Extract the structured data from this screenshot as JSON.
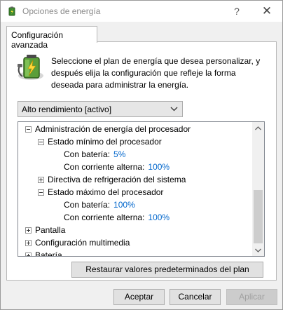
{
  "window": {
    "title": "Opciones de energía",
    "help_glyph": "?",
    "close_glyph": "✕"
  },
  "tab": {
    "label": "Configuración avanzada"
  },
  "intro": {
    "text": "Seleccione el plan de energía que desea personalizar, y después elija la configuración que refleje la forma deseada para administrar la energía."
  },
  "plan_select": {
    "value": "Alto rendimiento [activo]"
  },
  "tree": {
    "processor": {
      "label": "Administración de energía del procesador",
      "min_state": {
        "label": "Estado mínimo del procesador",
        "battery_label": "Con batería:",
        "battery_value": "5%",
        "ac_label": "Con corriente alterna:",
        "ac_value": "100%"
      },
      "cooling_policy": {
        "label": "Directiva de refrigeración del sistema"
      },
      "max_state": {
        "label": "Estado máximo del procesador",
        "battery_label": "Con batería:",
        "battery_value": "100%",
        "ac_label": "Con corriente alterna:",
        "ac_value": "100%"
      }
    },
    "display": {
      "label": "Pantalla"
    },
    "multimedia": {
      "label": "Configuración multimedia"
    },
    "battery": {
      "label": "Batería"
    }
  },
  "buttons": {
    "restore": "Restaurar valores predeterminados del plan",
    "ok": "Aceptar",
    "cancel": "Cancelar",
    "apply": "Aplicar"
  },
  "colors": {
    "value_link": "#0066cc",
    "disabled_text": "#a0a0a0"
  }
}
